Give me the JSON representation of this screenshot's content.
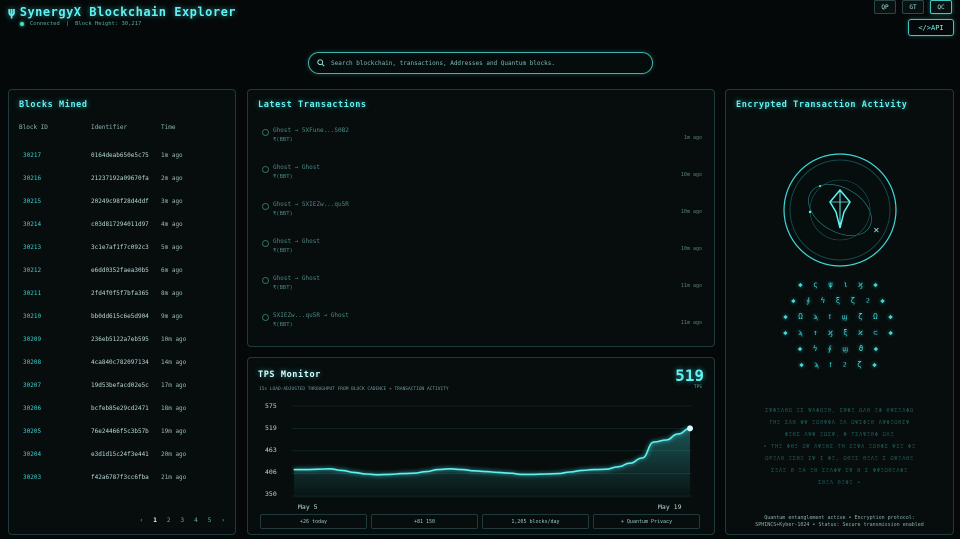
{
  "header": {
    "title": "SynergyX Blockchain Explorer",
    "psi": "ψ",
    "status": "Connected",
    "separator": "|",
    "block_height": "Block Height: 30,217",
    "toggles": [
      "QP",
      "GT",
      "QC"
    ],
    "api_label": "</>API"
  },
  "search": {
    "placeholder": "Search blockchain, transactions, Addresses and Quantum blocks."
  },
  "blocks": {
    "title": "Blocks Mined",
    "columns": [
      "Block ID",
      "Identifier",
      "Time"
    ],
    "rows": [
      {
        "id": "30217",
        "hash": "0164deab650e5c75",
        "time": "1m ago"
      },
      {
        "id": "30216",
        "hash": "21237192a09670fa",
        "time": "2m ago"
      },
      {
        "id": "30215",
        "hash": "20249c98f28d4ddf",
        "time": "3m ago"
      },
      {
        "id": "30214",
        "hash": "c03d817294011d97",
        "time": "4m ago"
      },
      {
        "id": "30213",
        "hash": "3c1e7af1f7c092c3",
        "time": "5m ago"
      },
      {
        "id": "30212",
        "hash": "e6dd0352faea30b5",
        "time": "6m ago"
      },
      {
        "id": "30211",
        "hash": "2fd4f0f5f7bfa365",
        "time": "8m ago"
      },
      {
        "id": "30210",
        "hash": "bb0dd615c6e5d904",
        "time": "9m ago"
      },
      {
        "id": "30209",
        "hash": "236eb5122a7eb595",
        "time": "10m ago"
      },
      {
        "id": "30208",
        "hash": "4ca840c782097134",
        "time": "14m ago"
      },
      {
        "id": "30207",
        "hash": "19d53befacd02e5c",
        "time": "17m ago"
      },
      {
        "id": "30206",
        "hash": "bcfeb85e29cd2471",
        "time": "18m ago"
      },
      {
        "id": "30205",
        "hash": "76e24466f5c3b57b",
        "time": "19m ago"
      },
      {
        "id": "30204",
        "hash": "e3d1d15c24f3e441",
        "time": "20m ago"
      },
      {
        "id": "30203",
        "hash": "f42a6787f3cc6fba",
        "time": "21m ago"
      }
    ],
    "pager": [
      "‹",
      "1",
      "2",
      "3",
      "4",
      "5",
      "›"
    ]
  },
  "transactions": {
    "title": "Latest Transactions",
    "rows": [
      {
        "from": "Ghost → 5XFune...S0B2",
        "amount": "₹(BBT)",
        "ago": "1m ago"
      },
      {
        "from": "Ghost → Ghost",
        "amount": "₹(BBT)",
        "ago": "10m ago"
      },
      {
        "from": "Ghost → 5XIEZw...qu5R",
        "amount": "₹(BBT)",
        "ago": "10m ago"
      },
      {
        "from": "Ghost → Ghost",
        "amount": "₹(BBT)",
        "ago": "10m ago"
      },
      {
        "from": "Ghost → Ghost",
        "amount": "₹(BBT)",
        "ago": "11m ago"
      },
      {
        "from": "5XIEZw...qu5R → Ghost",
        "amount": "₹(BBT)",
        "ago": "11m ago"
      }
    ]
  },
  "tps": {
    "title": "TPS Monitor",
    "value": "519",
    "unit": "TPS",
    "subtitle": "15s LOAD-ADJUSTED THROUGHPUT FROM BLOCK CADENCE + TRANSACTION ACTIVITY",
    "stats": [
      "+26 today",
      "+81 150",
      "1,205 blocks/day",
      "+ Quantum Privacy"
    ]
  },
  "chart_data": {
    "type": "area",
    "y_ticks": [
      "575",
      "519",
      "463",
      "406",
      "350"
    ],
    "x_ticks": [
      "May 5",
      "May 19"
    ],
    "ylim": [
      350,
      575
    ],
    "values": [
      416,
      416,
      417,
      418,
      414,
      409,
      405,
      403,
      404,
      406,
      407,
      411,
      416,
      418,
      416,
      413,
      411,
      409,
      407,
      404,
      404,
      405,
      406,
      410,
      414,
      416,
      417,
      423,
      432,
      445,
      485,
      490,
      505,
      519
    ]
  },
  "encrypted": {
    "title": "Encrypted Transaction Activity",
    "glyph_rows": [
      "◆ ς ψ ι ϗ ◆",
      "◆ ∮ ϟ ξ ζ ϩ ◆",
      "◆ Ω ϡ ϯ ϣ ζ Ω ◆",
      "◆ ϡ ↑ ϗ ξ ϰ ⊂ ◆",
      "◆ ϟ ∮ ϣ ϑ ◆",
      "◆ ϡ ϯ ϩ ζ ◆"
    ],
    "hidden_rows": [
      "ΣΨΦΞΛΘΩ ΞΣ ΨΛΦΩΞΘ, ΣΨΦΞ ΩΛΘ ΞΦ ΘΨΣΞΛΦΩ",
      "ΤΗΞ ΣΛΘ ΦΨ ΞΩΘΨΦΛ ΞΛ ΩΨΣΦΞΘ ΛΨΦΞΩΘΣΨ",
      "ΦΞΘΣ ΛΨΦ ΞΩΣΨ, Φ ΤΣΛΨΞΘΦ ΩΛΞ",
      "• ΤΗΞ ΦΘΞ ΩΨ ΛΨΞΘΣ ΤΗ ΣΞΨΛ ΞΩΘΦΣ ΨΙΞ ΦΞ",
      "ΩΡΞΛΘ ΞΣΘΞ ΣΨ Ι ΦΞ, ΩΘΞΣ ΘΞΛΞ Σ ΩΨΞΛΘΞ",
      "ΣΞΛΞ Θ ΞΑ ΞΘ ΣΞΛΦΨ ΣΨ Θ Σ ΦΨΞΩΘΞΛΦΞ",
      "ΣΘΞΛ ΘΞΦΞ •"
    ],
    "footer_1": "Quantum entanglement active • Encryption protocol:",
    "footer_2": "SPHINCS+Kyber-1024 • Status: Secure transmission enabled"
  },
  "colors": {
    "accent": "#3fd8d8",
    "background": "#050808",
    "panel_border": "#1e3a3a"
  }
}
